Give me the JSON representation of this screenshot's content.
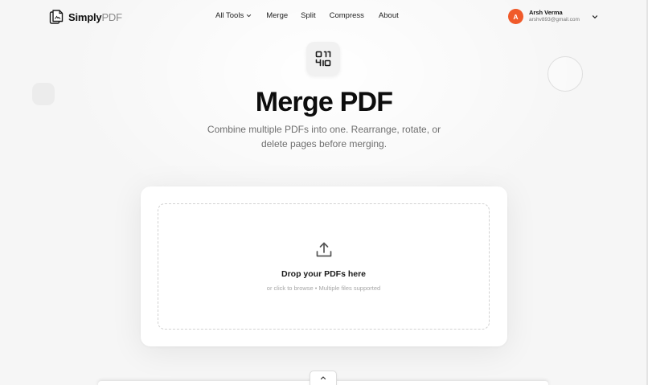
{
  "header": {
    "logo": {
      "name_main": "Simply",
      "name_accent": "PDF",
      "icon": "pdf-logo-icon"
    },
    "nav": {
      "all_tools": "All Tools",
      "merge": "Merge",
      "split": "Split",
      "compress": "Compress",
      "about": "About"
    },
    "user": {
      "initial": "A",
      "name": "Arsh Verma",
      "email": "arshv893@gmail.com",
      "avatar_color": "#f05a2a"
    }
  },
  "hero": {
    "icon": "merge-pdf-icon",
    "title": "Merge PDF",
    "subtitle": "Combine multiple PDFs into one. Rearrange, rotate, or delete pages before merging."
  },
  "upload": {
    "icon": "upload-icon",
    "title": "Drop your PDFs here",
    "hint": "or click to browse • Multiple files supported"
  },
  "colors": {
    "background": "#f6f6f6",
    "card": "#ffffff",
    "avatar": "#f05a2a",
    "text_primary": "#0d0d0d",
    "text_muted": "#6e6e6e"
  }
}
